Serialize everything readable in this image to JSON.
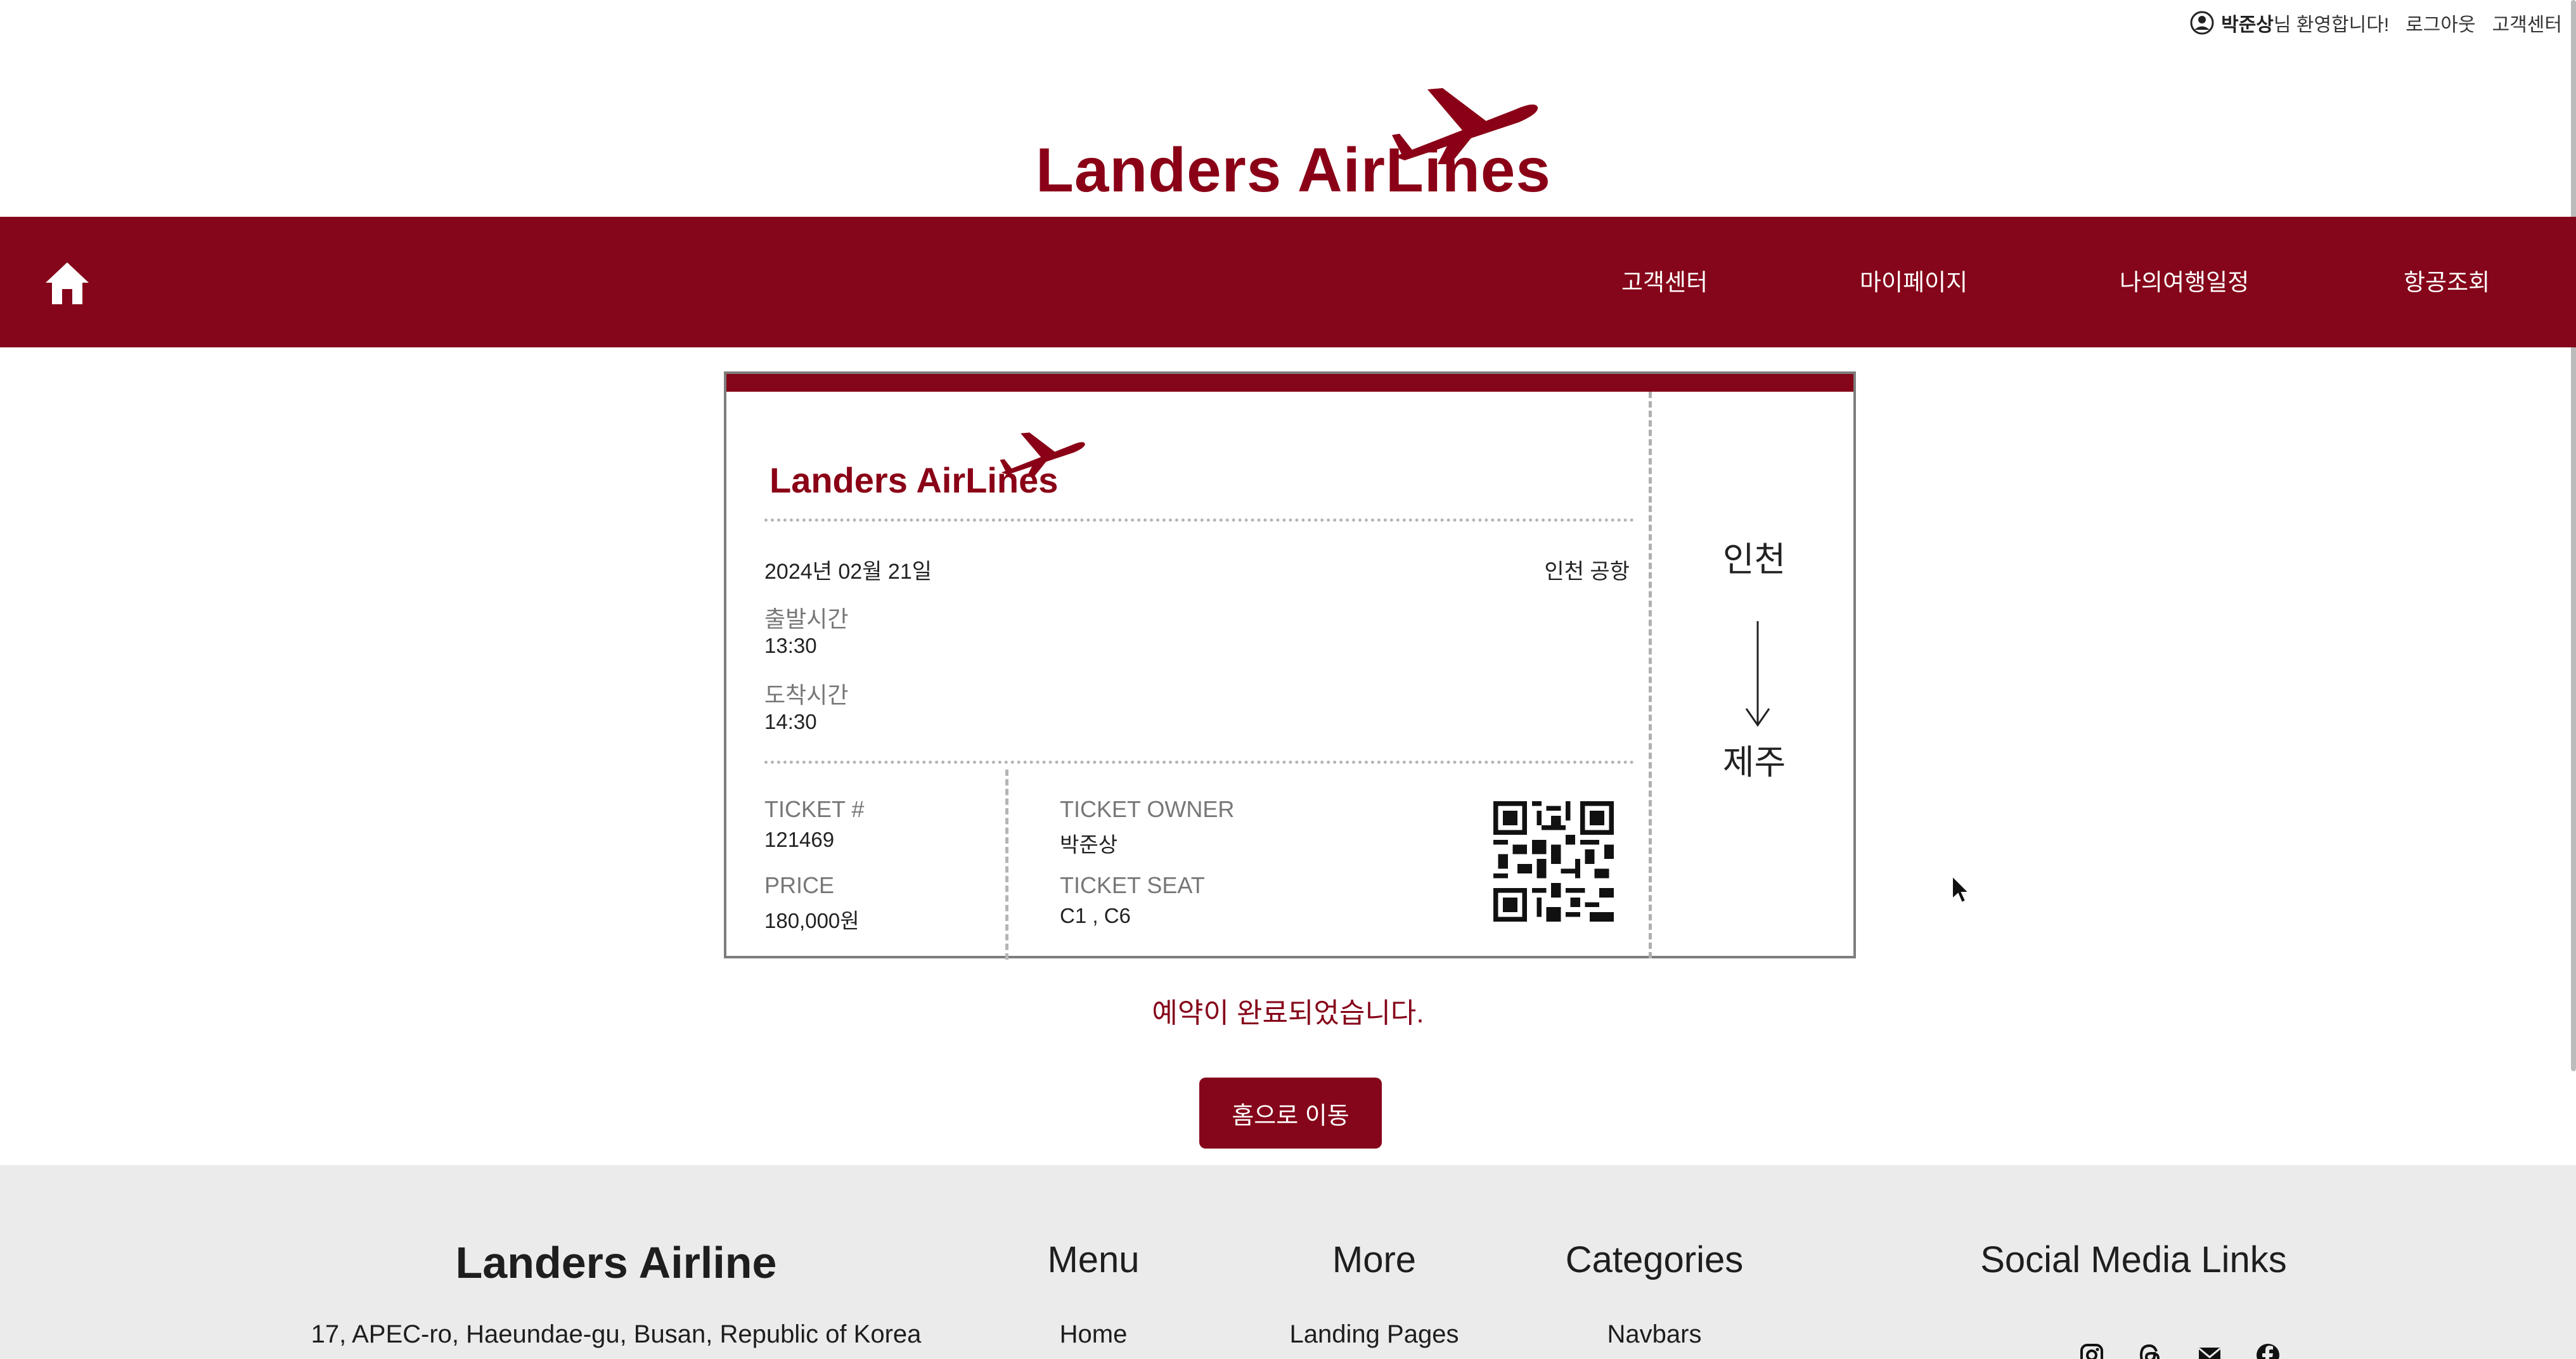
{
  "topbar": {
    "user_name": "박준상",
    "welcome_suffix": "님 환영합니다!",
    "logout": "로그아웃",
    "support": "고객센터",
    "user_icon": "user-circle-icon"
  },
  "brand": {
    "logo_text": "Landers AirLines",
    "logo_icon": "airplane-icon"
  },
  "nav": {
    "home_icon": "home-icon",
    "items": [
      "고객센터",
      "마이페이지",
      "나의여행일정",
      "항공조회"
    ]
  },
  "ticket": {
    "date": "2024년 02월 21일",
    "airport": "인천 공항",
    "departure_label": "출발시간",
    "departure_time": "13:30",
    "arrival_label": "도착시간",
    "arrival_time": "14:30",
    "ticket_no_label": "TICKET #",
    "ticket_no": "121469",
    "price_label": "PRICE",
    "price": "180,000원",
    "owner_label": "TICKET OWNER",
    "owner": "박준상",
    "seat_label": "TICKET SEAT",
    "seat": "C1 , C6",
    "from": "인천",
    "to": "제주",
    "qr_icon": "qr-code-icon",
    "arrow_icon": "arrow-down-icon"
  },
  "confirmation": "예약이 완료되었습니다.",
  "home_button": "홈으로 이동",
  "footer": {
    "brand": "Landers Airline",
    "address": "17, APEC-ro, Haeundae-gu, Busan, Republic of Korea",
    "menu_title": "Menu",
    "menu_link": "Home",
    "more_title": "More",
    "more_link": "Landing Pages",
    "categories_title": "Categories",
    "categories_link": "Navbars",
    "social_title": "Social Media Links",
    "social_icons": [
      "instagram-icon",
      "threads-icon",
      "mail-icon",
      "facebook-icon"
    ]
  },
  "colors": {
    "brand": "#85051a",
    "footer_bg": "#ebebeb"
  }
}
